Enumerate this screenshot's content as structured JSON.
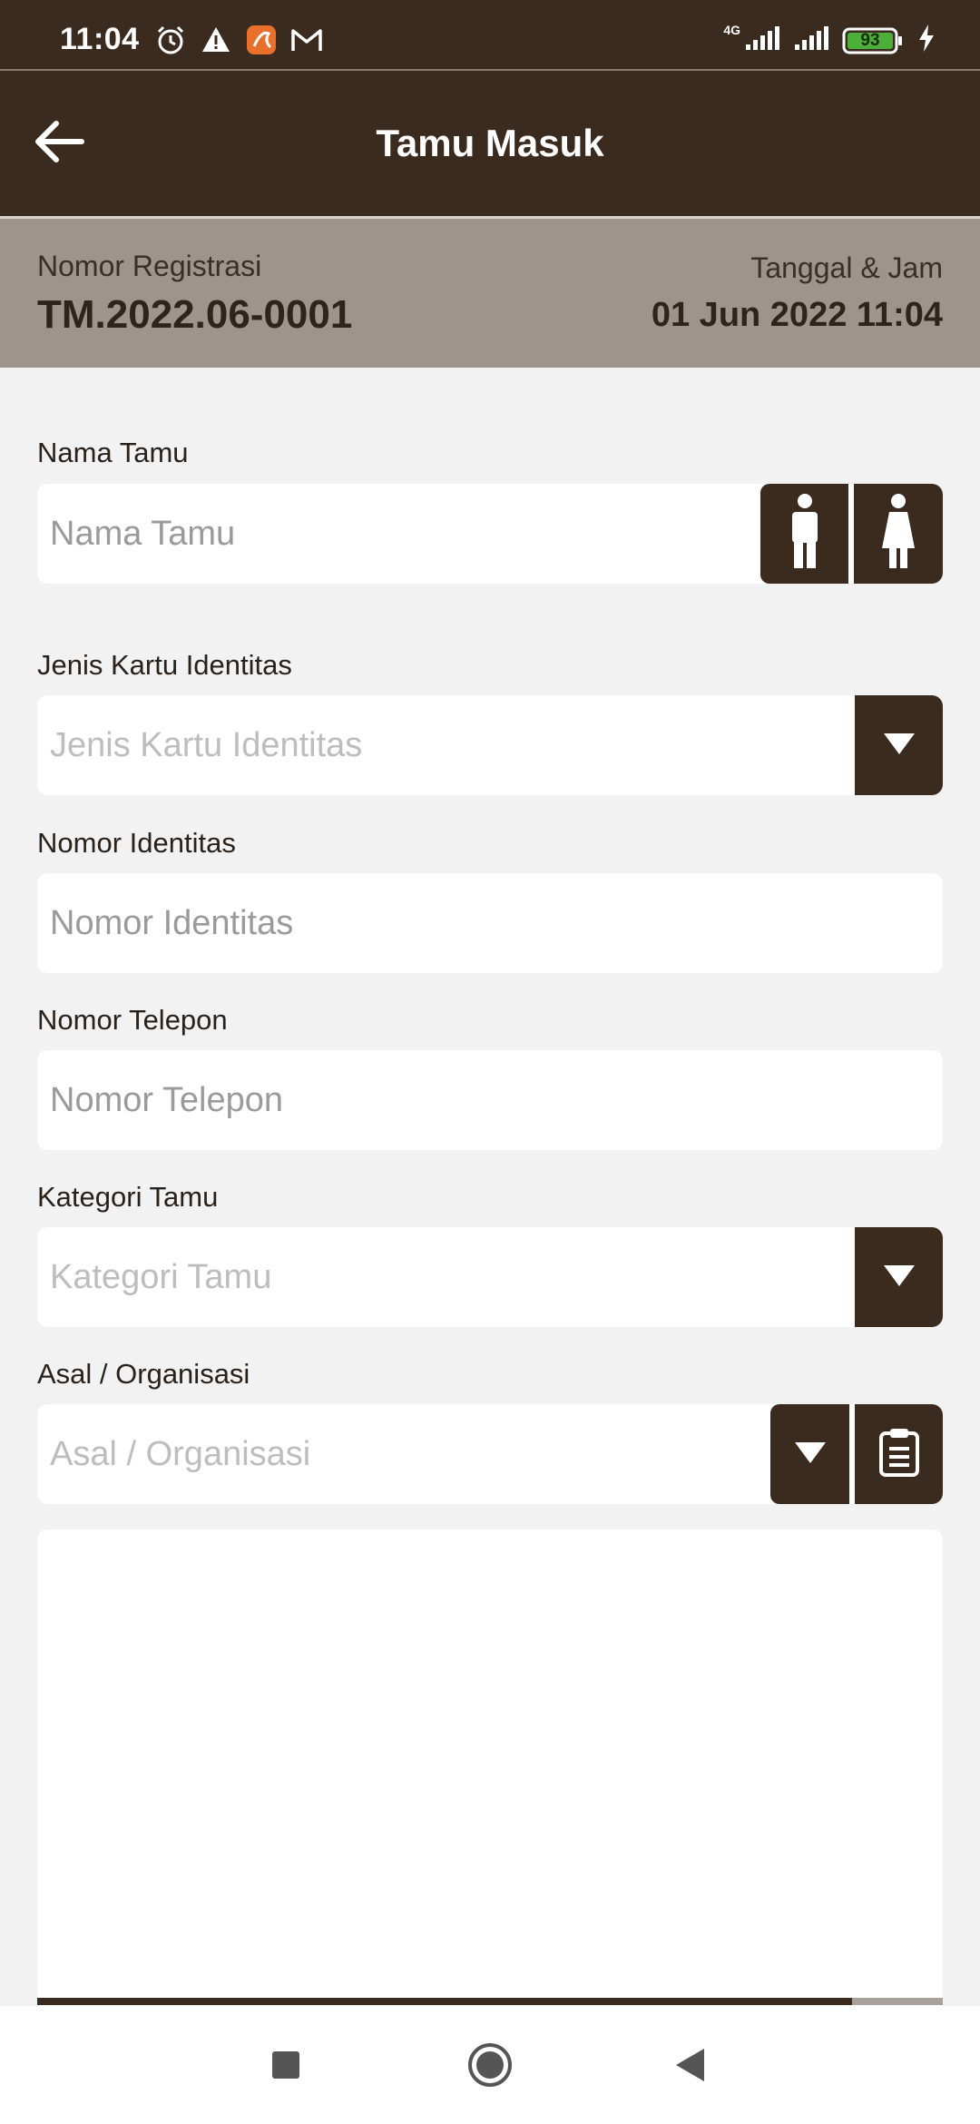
{
  "status_bar": {
    "time": "11:04",
    "left_icons": [
      "alarm-icon",
      "warning-icon",
      "app-notification-icon",
      "gmail-icon"
    ],
    "network_label": "4G",
    "battery_level": "93"
  },
  "app_bar": {
    "title": "Tamu Masuk",
    "back_icon": "arrow-left-icon"
  },
  "registration": {
    "number_label": "Nomor Registrasi",
    "number_value": "TM.2022.06-0001",
    "datetime_label": "Tanggal & Jam",
    "datetime_value": "01 Jun 2022 11:04"
  },
  "form": {
    "guest_name": {
      "label": "Nama Tamu",
      "placeholder": "Nama Tamu",
      "value": ""
    },
    "gender_buttons": [
      "male-icon",
      "female-icon"
    ],
    "id_card_type": {
      "label": "Jenis Kartu Identitas",
      "placeholder": "Jenis Kartu Identitas",
      "value": ""
    },
    "id_number": {
      "label": "Nomor Identitas",
      "placeholder": "Nomor Identitas",
      "value": ""
    },
    "phone": {
      "label": "Nomor Telepon",
      "placeholder": "Nomor Telepon",
      "value": ""
    },
    "guest_category": {
      "label": "Kategori Tamu",
      "placeholder": "Kategori Tamu",
      "value": ""
    },
    "origin": {
      "label": "Asal / Organisasi",
      "placeholder": "Asal / Organisasi",
      "value": ""
    },
    "notes": {
      "value": ""
    },
    "scroll_progress": 0.9
  },
  "colors": {
    "primary": "#3b2b1f",
    "band": "#9d948d",
    "background": "#f2f2f2"
  },
  "nav_bar": {
    "buttons": [
      "recents-icon",
      "home-icon",
      "back-icon"
    ]
  }
}
